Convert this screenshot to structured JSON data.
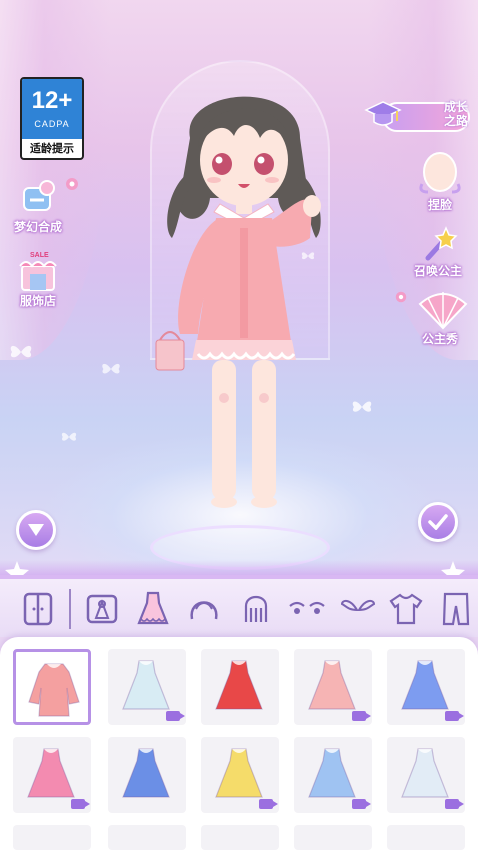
{
  "age_badge": {
    "rating": "12+",
    "org": "CADPA",
    "tip": "适龄提示"
  },
  "left_buttons": [
    {
      "label": "梦幻合成",
      "icon": "dream-merge-icon"
    },
    {
      "label": "服饰店",
      "icon": "clothing-shop-icon",
      "sign": "SALE"
    }
  ],
  "growth": {
    "label_line1": "成长",
    "label_line2": "之路",
    "icon": "graduation-cap-icon"
  },
  "right_buttons": [
    {
      "label": "捏脸",
      "icon": "face-edit-icon"
    },
    {
      "label": "召唤公主",
      "icon": "magic-wand-icon"
    },
    {
      "label": "公主秀",
      "icon": "fan-icon"
    }
  ],
  "tabs": [
    {
      "name": "wardrobe",
      "icon": "wardrobe-icon"
    },
    {
      "name": "outfit-set",
      "icon": "outfit-set-icon"
    },
    {
      "name": "dress",
      "icon": "dress-icon",
      "active": true
    },
    {
      "name": "hair",
      "icon": "hair-icon"
    },
    {
      "name": "back-hair",
      "icon": "back-hair-icon"
    },
    {
      "name": "eyes",
      "icon": "eyes-icon"
    },
    {
      "name": "wings",
      "icon": "wings-icon"
    },
    {
      "name": "top",
      "icon": "shirt-icon"
    },
    {
      "name": "bottom",
      "icon": "pants-icon"
    }
  ],
  "items": [
    {
      "color": "#f4a0a0",
      "style": "coat",
      "selected": true,
      "video": false
    },
    {
      "color": "#d8ecf4",
      "style": "dress",
      "selected": false,
      "video": true
    },
    {
      "color": "#e84848",
      "style": "dress",
      "selected": false,
      "video": false
    },
    {
      "color": "#f6b4b4",
      "style": "dress",
      "selected": false,
      "video": true
    },
    {
      "color": "#7d9cf0",
      "style": "dress",
      "selected": false,
      "video": true
    },
    {
      "color": "#f38bb0",
      "style": "dress",
      "selected": false,
      "video": true
    },
    {
      "color": "#6b8fe6",
      "style": "dress",
      "selected": false,
      "video": false
    },
    {
      "color": "#f5dc6a",
      "style": "dress",
      "selected": false,
      "video": true
    },
    {
      "color": "#9fc3f2",
      "style": "dress",
      "selected": false,
      "video": true
    },
    {
      "color": "#e2ecf6",
      "style": "dress",
      "selected": false,
      "video": true
    }
  ],
  "colors": {
    "accent": "#b691e6",
    "panel": "#ffffff",
    "tab_icon": "#7b64b2"
  }
}
